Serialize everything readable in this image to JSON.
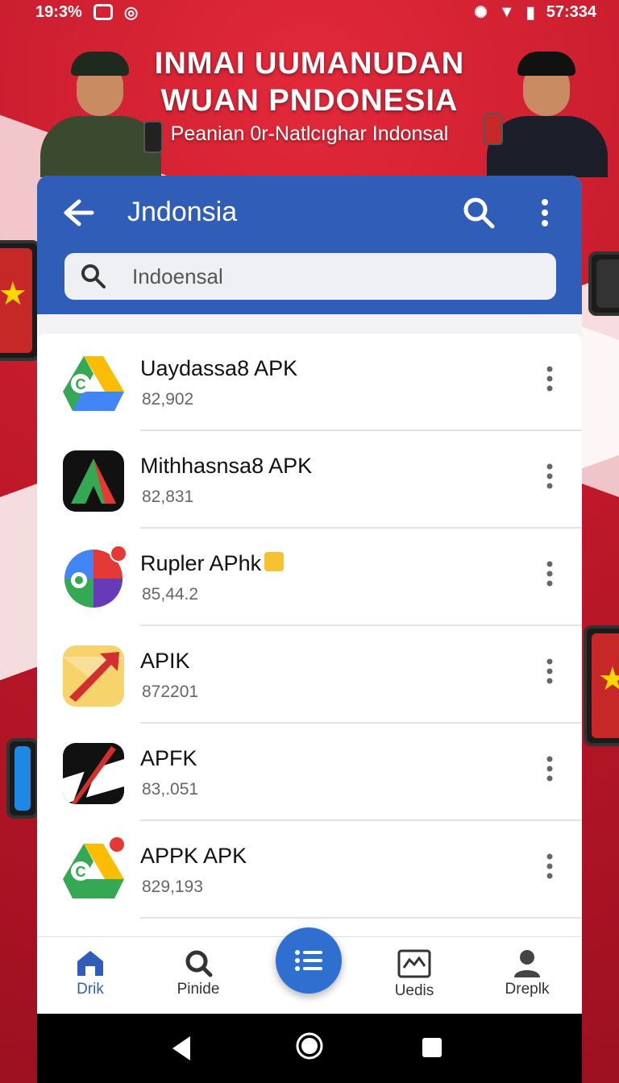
{
  "status_bar": {
    "time_left": "19:3%",
    "time_right": "57:334"
  },
  "hero": {
    "headline_line1": "INMAI UUMANUDAN",
    "headline_line2": "WUAN PNDONESIA",
    "subtitle": "Peanian 0r-Natlcıghar Indonsal"
  },
  "app_bar": {
    "title": "Jndonsia",
    "icons": [
      "back-icon",
      "search-icon",
      "more-vert-icon"
    ]
  },
  "search": {
    "value": "",
    "placeholder": "Indoensal"
  },
  "apps": [
    {
      "name": "Uaydassa8 APK",
      "meta": "82,902",
      "icon": "drive-style-icon",
      "badge": false
    },
    {
      "name": "Mithhasnsa8 APK",
      "meta": "82,831",
      "icon": "triangle-logo-icon",
      "badge": false
    },
    {
      "name": "Rupler APhk",
      "meta": "85,44.2",
      "icon": "maps-style-icon",
      "badge": true
    },
    {
      "name": "APIK",
      "meta": "872201",
      "icon": "envelope-arrow-icon",
      "badge": false
    },
    {
      "name": "APFK",
      "meta": "83,.051",
      "icon": "slash-logo-icon",
      "badge": false
    },
    {
      "name": "APPK APK",
      "meta": "829,193",
      "icon": "drive-style-icon",
      "badge": false
    }
  ],
  "bottom_nav": {
    "items": [
      {
        "label": "Drik",
        "icon": "home-icon",
        "active": true
      },
      {
        "label": "Pinide",
        "icon": "search-icon",
        "active": false
      },
      {
        "label": "",
        "icon": "list-icon",
        "active": false
      },
      {
        "label": "Uedis",
        "icon": "updates-icon",
        "active": false
      },
      {
        "label": "Dreplk",
        "icon": "profile-icon",
        "active": false
      }
    ]
  },
  "colors": {
    "primary": "#2f5db8",
    "fab": "#2f6fd0",
    "banner_red": "#c0192a"
  }
}
